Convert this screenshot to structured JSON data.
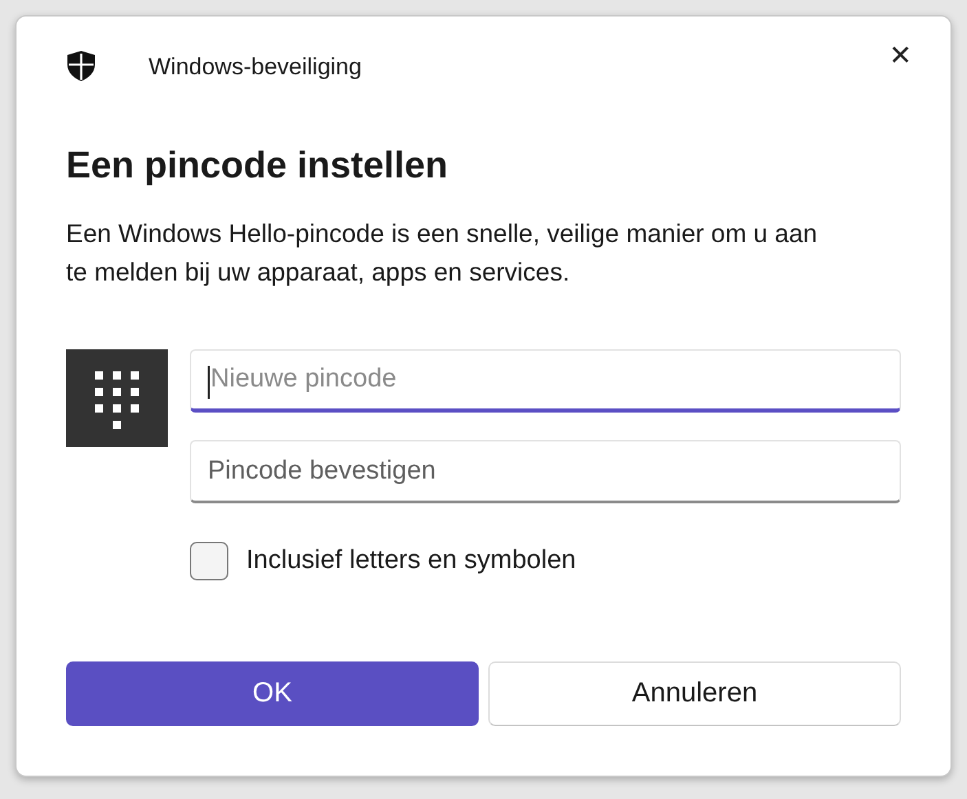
{
  "window": {
    "title": "Windows-beveiliging",
    "close": "✕"
  },
  "heading": "Een pincode instellen",
  "description": "Een Windows Hello-pincode is een snelle, veilige manier om u aan te melden bij uw apparaat, apps en services.",
  "fields": [
    {
      "placeholder": "Nieuwe pincode",
      "focused": true
    },
    {
      "placeholder": "Pincode bevestigen",
      "focused": false
    }
  ],
  "checkbox": {
    "label": "Inclusief letters en symbolen",
    "checked": false
  },
  "buttons": [
    {
      "label": "OK",
      "kind": "primary"
    },
    {
      "label": "Annuleren",
      "kind": "secondary"
    }
  ]
}
